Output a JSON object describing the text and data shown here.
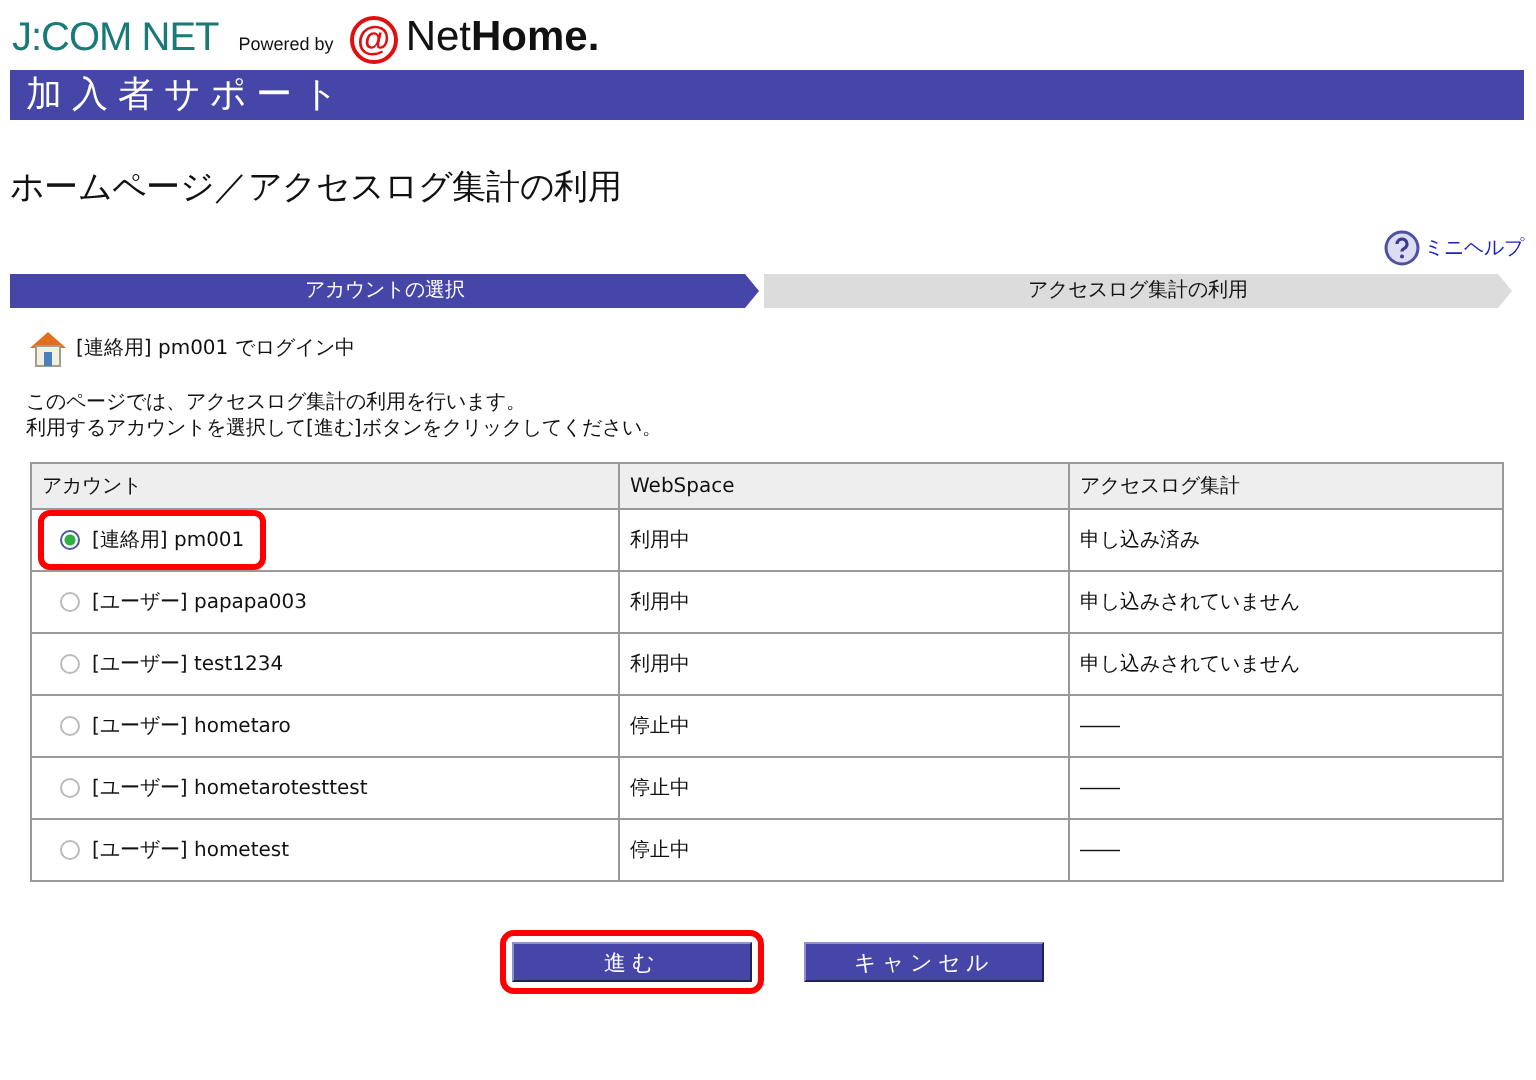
{
  "logo": {
    "brand": "J:COM NET",
    "powered": "Powered by",
    "at": "@",
    "net": "Net",
    "home": "Home."
  },
  "banner": {
    "title": "加入者サポート"
  },
  "page_title": "ホームページ／アクセスログ集計の利用",
  "help_link": "ミニヘルプ",
  "steps": [
    {
      "label": "アカウントの選択",
      "selected": true
    },
    {
      "label": "アクセスログ集計の利用",
      "selected": false
    }
  ],
  "login_status": "[連絡用] pm001 でログイン中",
  "instructions": [
    "このページでは、アクセスログ集計の利用を行います。",
    "利用するアカウントを選択して[進む]ボタンをクリックしてください。"
  ],
  "table": {
    "columns": [
      "アカウント",
      "WebSpace",
      "アクセスログ集計"
    ],
    "rows": [
      {
        "account": "[連絡用] pm001",
        "webspace": "利用中",
        "access_log": "申し込み済み",
        "selected": true,
        "highlighted": true
      },
      {
        "account": "[ユーザー] papapa003",
        "webspace": "利用中",
        "access_log": "申し込みされていません",
        "selected": false,
        "highlighted": false
      },
      {
        "account": "[ユーザー] test1234",
        "webspace": "利用中",
        "access_log": "申し込みされていません",
        "selected": false,
        "highlighted": false
      },
      {
        "account": "[ユーザー] hometaro",
        "webspace": "停止中",
        "access_log": "――",
        "selected": false,
        "highlighted": false
      },
      {
        "account": "[ユーザー] hometarotesttest",
        "webspace": "停止中",
        "access_log": "――",
        "selected": false,
        "highlighted": false
      },
      {
        "account": "[ユーザー] hometest",
        "webspace": "停止中",
        "access_log": "――",
        "selected": false,
        "highlighted": false
      }
    ]
  },
  "buttons": [
    {
      "label": "進む",
      "highlighted": true
    },
    {
      "label": "キャンセル",
      "highlighted": false
    }
  ]
}
